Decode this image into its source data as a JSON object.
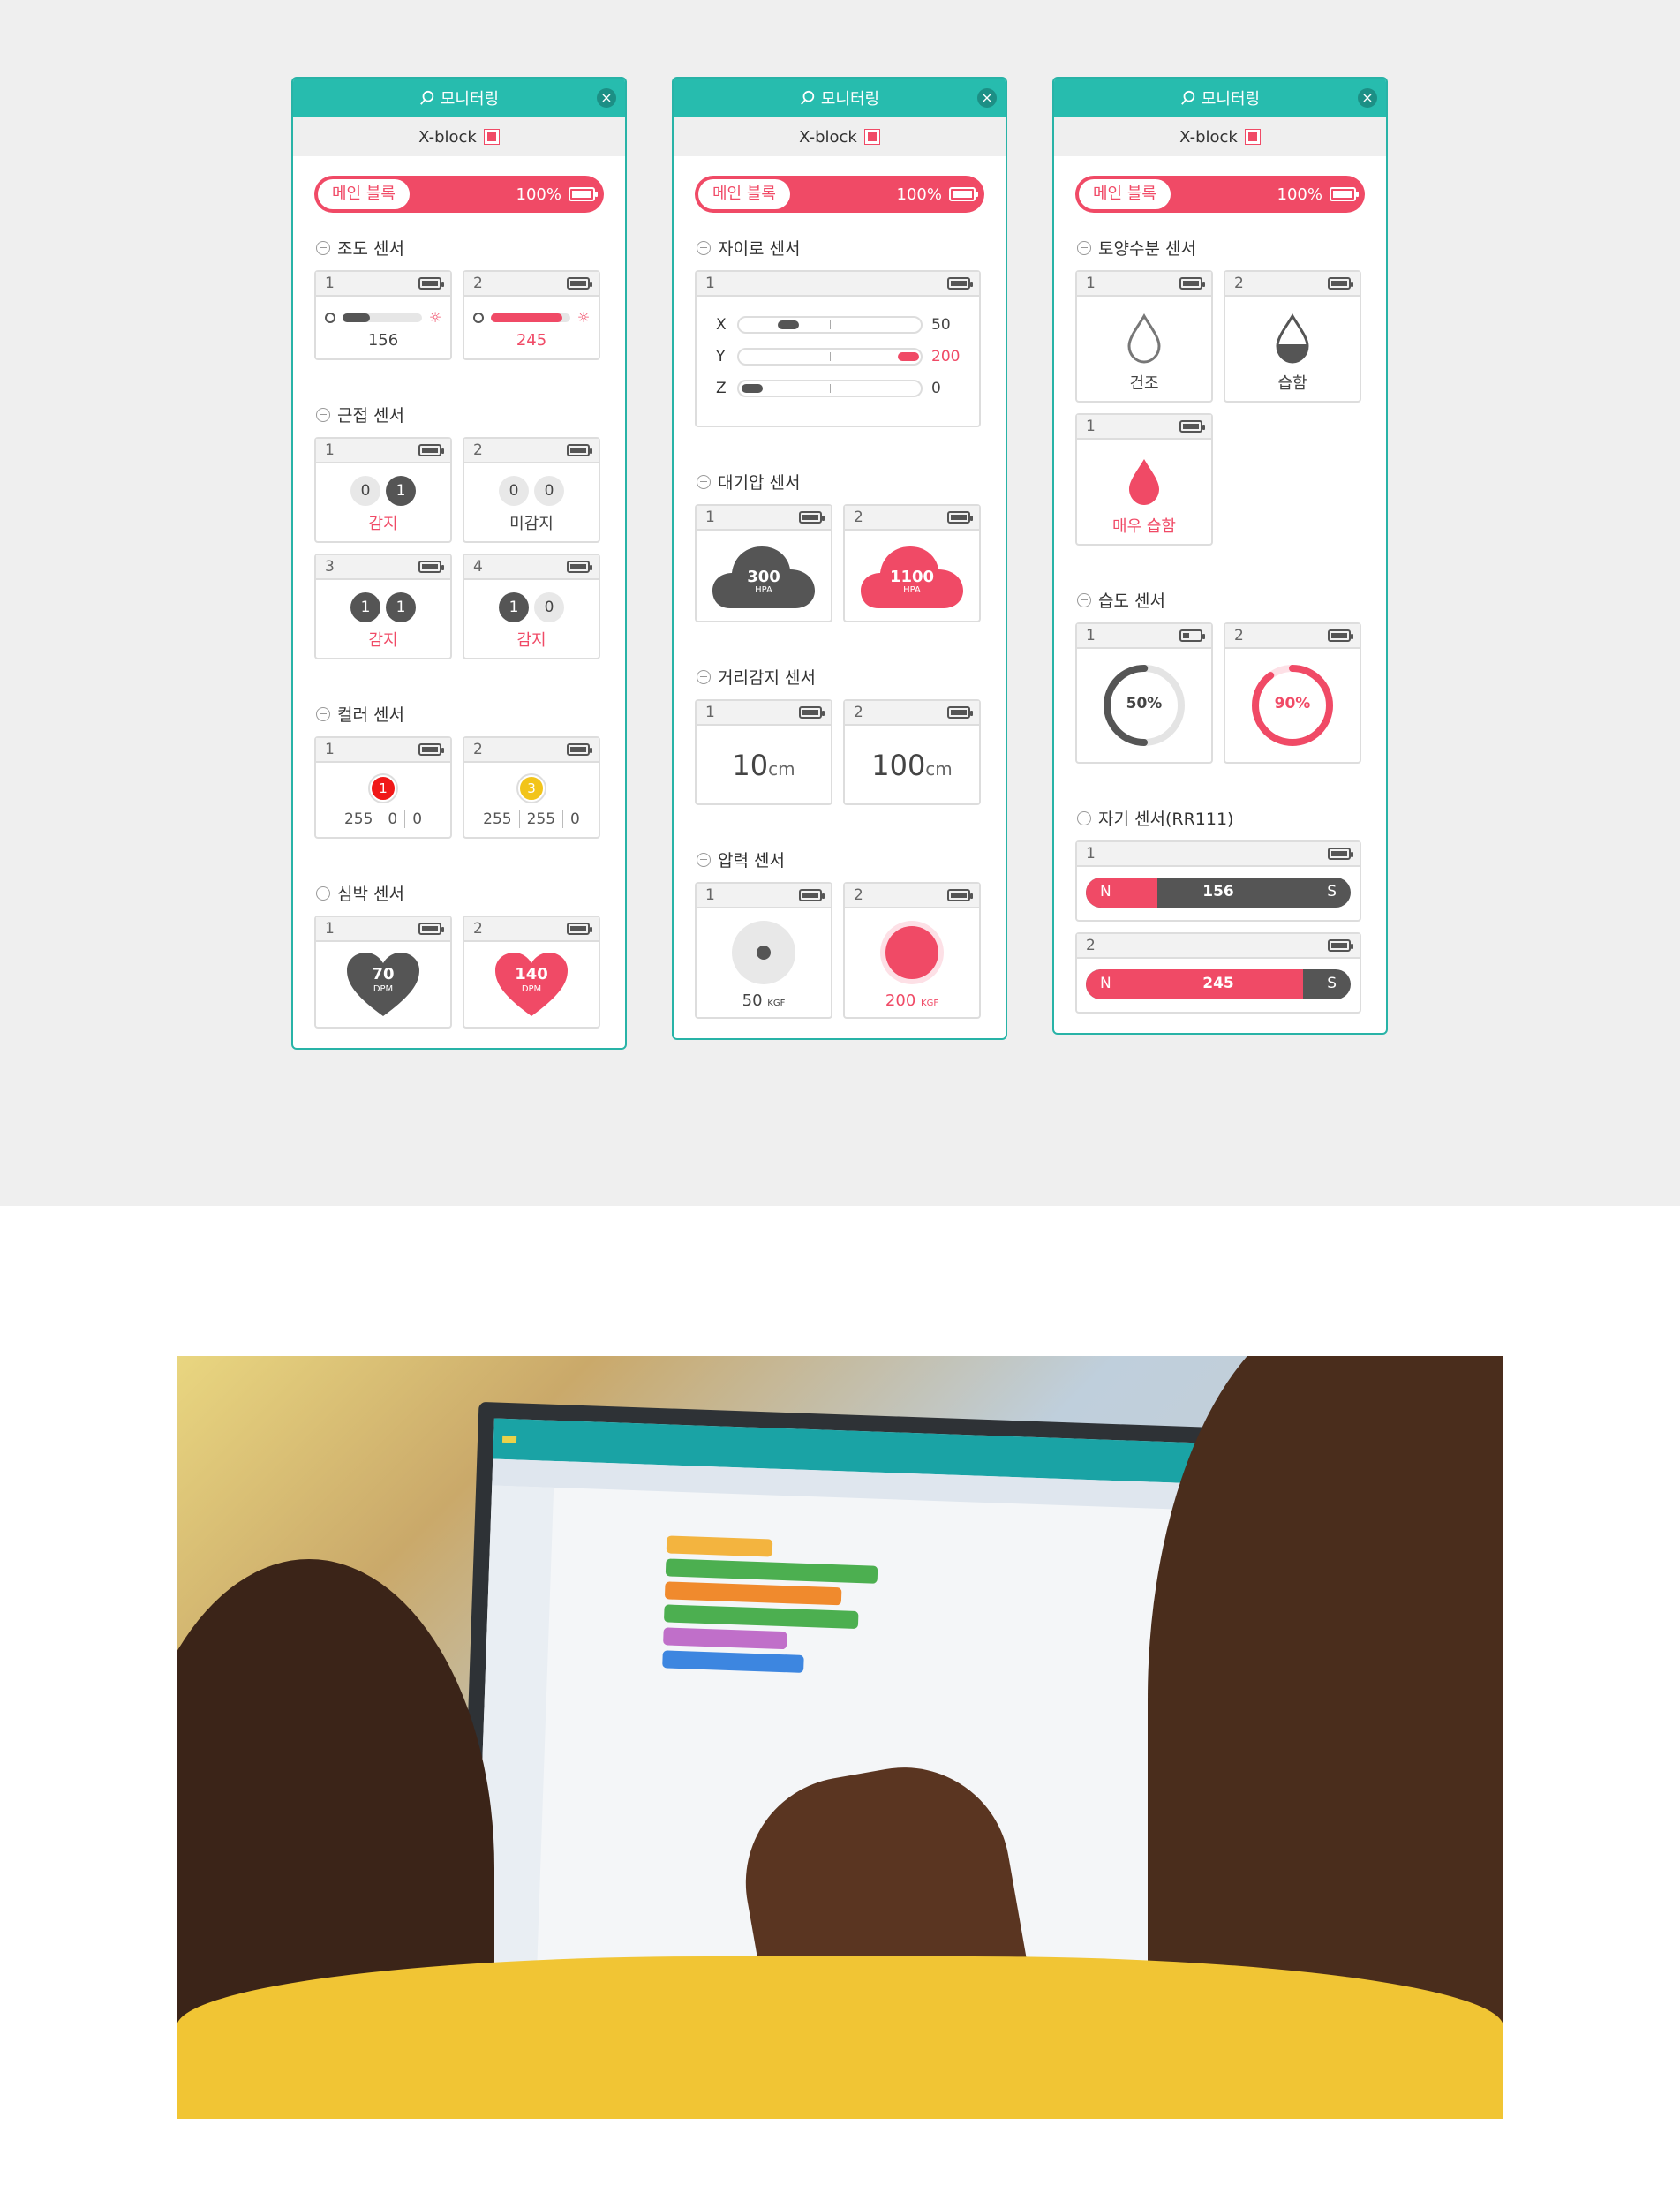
{
  "panels": [
    {
      "header": "모니터링",
      "device": "X-block",
      "main_block": {
        "label": "메인 블록",
        "battery": "100%"
      },
      "sections": [
        {
          "title": "조도 센서",
          "cards": [
            {
              "id": "1",
              "value": "156",
              "level": 0.35
            },
            {
              "id": "2",
              "value": "245",
              "level": 0.9
            }
          ]
        },
        {
          "title": "근접 센서",
          "cards": [
            {
              "id": "1",
              "a": "0",
              "b": "1",
              "label": "감지"
            },
            {
              "id": "2",
              "a": "0",
              "b": "0",
              "label": "미감지"
            },
            {
              "id": "3",
              "a": "1",
              "b": "1",
              "label": "감지"
            },
            {
              "id": "4",
              "a": "1",
              "b": "0",
              "label": "감지"
            }
          ]
        },
        {
          "title": "컬러 센서",
          "cards": [
            {
              "id": "1",
              "dot": "1",
              "r": "255",
              "g": "0",
              "b": "0",
              "color": "#f01818"
            },
            {
              "id": "2",
              "dot": "3",
              "r": "255",
              "g": "255",
              "b": "0",
              "color": "#f2c41a"
            }
          ]
        },
        {
          "title": "심박 센서",
          "cards": [
            {
              "id": "1",
              "value": "70",
              "unit": "DPM",
              "color": "#555555"
            },
            {
              "id": "2",
              "value": "140",
              "unit": "DPM",
              "color": "#f04a66"
            }
          ]
        }
      ]
    },
    {
      "header": "모니터링",
      "device": "X-block",
      "main_block": {
        "label": "메인 블록",
        "battery": "100%"
      },
      "sections": [
        {
          "title": "자이로 센서",
          "cards": [
            {
              "id": "1",
              "x": "50",
              "y": "200",
              "z": "0"
            }
          ]
        },
        {
          "title": "대기압 센서",
          "cards": [
            {
              "id": "1",
              "value": "300",
              "unit": "HPA",
              "color": "#555555"
            },
            {
              "id": "2",
              "value": "1100",
              "unit": "HPA",
              "color": "#f04a66"
            }
          ]
        },
        {
          "title": "거리감지 센서",
          "cards": [
            {
              "id": "1",
              "value": "10",
              "unit": "cm"
            },
            {
              "id": "2",
              "value": "100",
              "unit": "cm"
            }
          ]
        },
        {
          "title": "압력 센서",
          "cards": [
            {
              "id": "1",
              "value": "50",
              "unit": "KGF"
            },
            {
              "id": "2",
              "value": "200",
              "unit": "KGF"
            }
          ]
        }
      ]
    },
    {
      "header": "모니터링",
      "device": "X-block",
      "main_block": {
        "label": "메인 블록",
        "battery": "100%"
      },
      "sections": [
        {
          "title": "토양수분 센서",
          "cards": [
            {
              "id": "1",
              "label": "건조"
            },
            {
              "id": "2",
              "label": "습함"
            },
            {
              "id": "1",
              "label": "매우 습함"
            }
          ]
        },
        {
          "title": "습도 센서",
          "cards": [
            {
              "id": "1",
              "value": "50%",
              "level": 0.5
            },
            {
              "id": "2",
              "value": "90%",
              "level": 0.9
            }
          ]
        },
        {
          "title": "자기 센서(RR111)",
          "cards": [
            {
              "id": "1",
              "n": "N",
              "s": "S",
              "value": "156",
              "level": 0.27
            },
            {
              "id": "2",
              "n": "N",
              "s": "S",
              "value": "245",
              "level": 0.82
            }
          ]
        }
      ]
    }
  ],
  "colors": {
    "accent": "#27bcae",
    "pink": "#f04a66",
    "dark": "#555555"
  }
}
